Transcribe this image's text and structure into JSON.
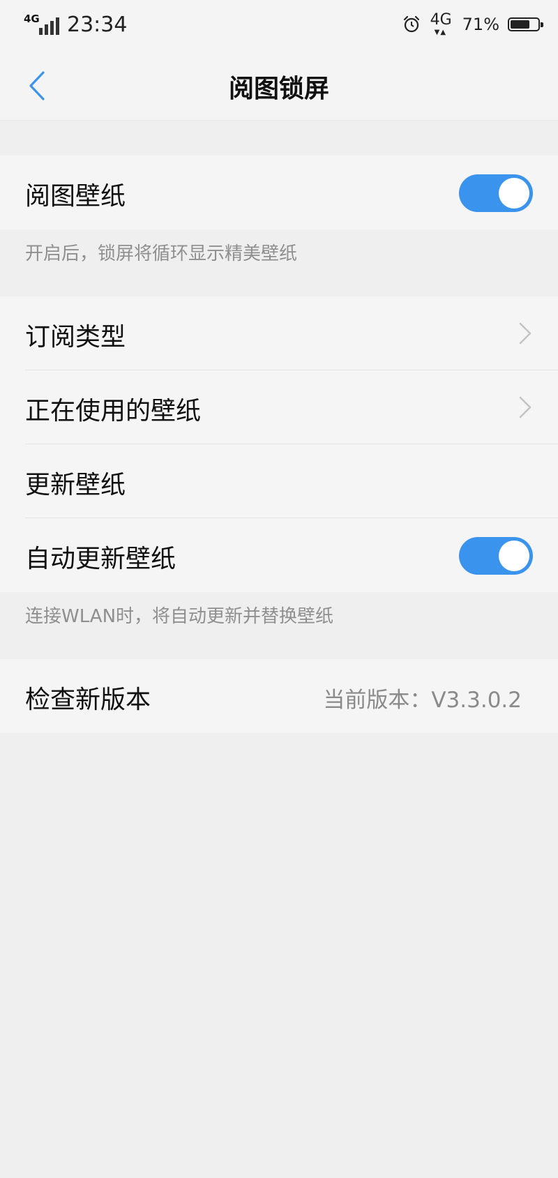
{
  "status_bar": {
    "signal_label": "4G",
    "time": "23:34",
    "network": "4G",
    "network_arrows": "▼▲",
    "battery_percent": "71%",
    "battery_level": 0.71,
    "icons": [
      "signal-icon",
      "alarm-icon",
      "network-4g-icon",
      "battery-icon"
    ]
  },
  "header": {
    "back_icon": "chevron-left-icon",
    "title": "阅图锁屏"
  },
  "section1": {
    "wallpaper_label": "阅图壁纸",
    "wallpaper_toggle_on": true,
    "note": "开启后，锁屏将循环显示精美壁纸"
  },
  "section2": {
    "items": [
      {
        "label": "订阅类型",
        "control": "chevron"
      },
      {
        "label": "正在使用的壁纸",
        "control": "chevron"
      },
      {
        "label": "更新壁纸",
        "control": "none"
      },
      {
        "label": "自动更新壁纸",
        "control": "toggle",
        "on": true
      }
    ],
    "note": "连接WLAN时，将自动更新并替换壁纸"
  },
  "section3": {
    "check_label": "检查新版本",
    "version_text": "当前版本：V3.3.0.2"
  },
  "colors": {
    "accent": "#3a93ec",
    "background": "#efefef",
    "row_background": "#f5f5f5",
    "secondary_text": "#8f8f8f"
  }
}
